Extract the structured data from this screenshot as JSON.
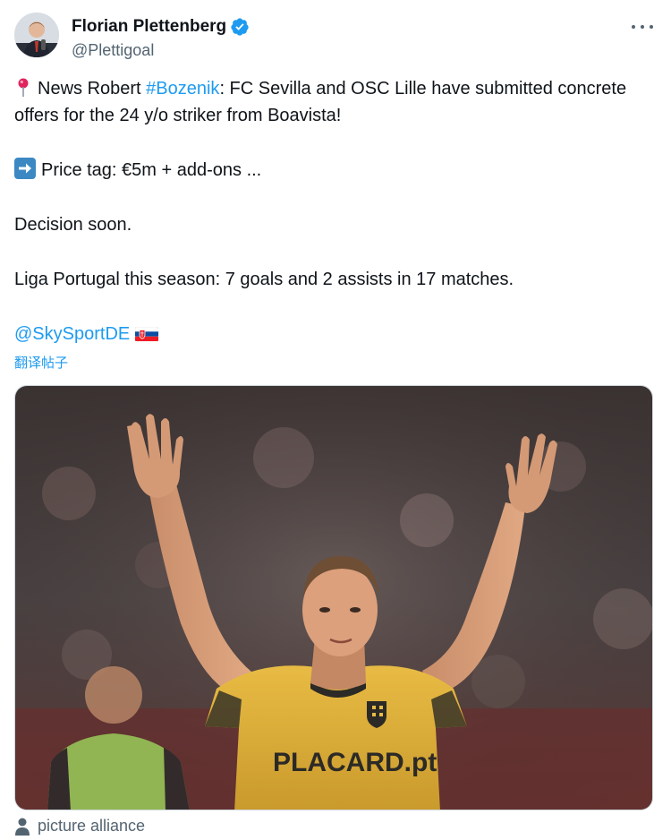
{
  "author": {
    "name": "Florian Plettenberg",
    "handle": "@Plettigoal",
    "verified": true
  },
  "tweet": {
    "line1_prefix": "News Robert ",
    "hashtag": "#Bozenik",
    "line1_suffix": ": FC Sevilla and OSC Lille have submitted concrete offers for the 24 y/o striker from Boavista!",
    "price": "Price tag: €5m + add-ons ...",
    "decision": "Decision soon.",
    "stats": "Liga Portugal this season: 7 goals and 2 assists in 17 matches.",
    "mention": "@SkySportDE"
  },
  "translate_label": "翻译帖子",
  "media": {
    "jersey_sponsor": "PLACARD.pt",
    "credit": "picture alliance"
  },
  "colors": {
    "link": "#1d9bf0",
    "secondary_text": "#536471",
    "jersey": "#e0b43c"
  },
  "icons": [
    "pin-icon",
    "right-arrow-icon",
    "slovakia-flag-icon",
    "verified-badge-icon",
    "more-options-icon",
    "person-icon"
  ]
}
